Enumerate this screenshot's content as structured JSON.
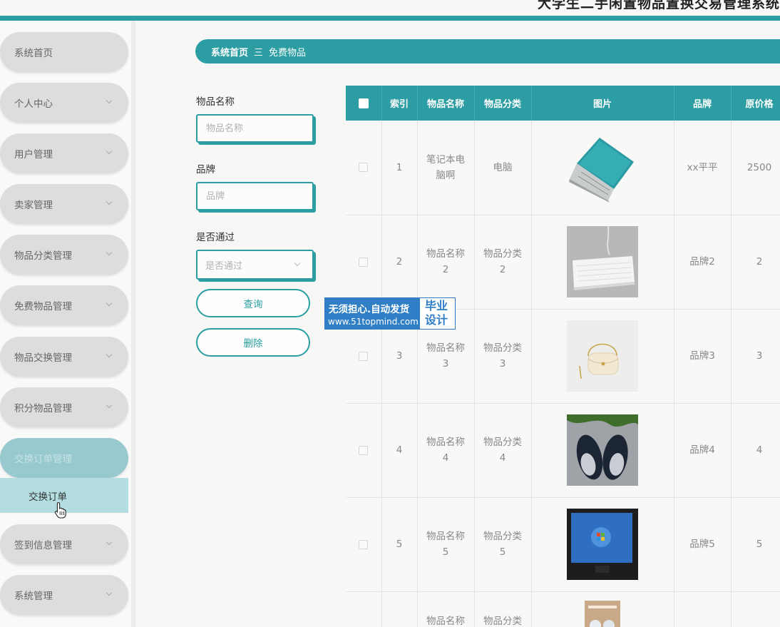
{
  "header": {
    "title": "大学生二手闲置物品置换交易管理系统"
  },
  "sidebar": {
    "items": [
      {
        "label": "系统首页"
      },
      {
        "label": "个人中心"
      },
      {
        "label": "用户管理"
      },
      {
        "label": "卖家管理"
      },
      {
        "label": "物品分类管理"
      },
      {
        "label": "免费物品管理"
      },
      {
        "label": "物品交换管理"
      },
      {
        "label": "积分物品管理"
      },
      {
        "label": "交换订单管理"
      },
      {
        "label": "签到信息管理"
      },
      {
        "label": "系统管理"
      }
    ],
    "submenu_label": "交换订单"
  },
  "breadcrumb": {
    "home": "系统首页",
    "separator": "三",
    "current": "免费物品"
  },
  "search": {
    "name_label": "物品名称",
    "name_placeholder": "物品名称",
    "brand_label": "品牌",
    "brand_placeholder": "品牌",
    "pass_label": "是否通过",
    "pass_placeholder": "是否通过",
    "query_button": "查询",
    "delete_button": "删除"
  },
  "watermark": {
    "line1": "无须担心.自动发货",
    "line2": "www.51topmind.com",
    "right1": "毕业",
    "right2": "设计"
  },
  "table": {
    "headers": [
      "索引",
      "物品名称",
      "物品分类",
      "图片",
      "品牌",
      "原价格"
    ],
    "rows": [
      {
        "index": "1",
        "name": "笔记本电脑啊",
        "category": "电脑",
        "image": "laptop-image",
        "brand": "xx平平",
        "price": "2500"
      },
      {
        "index": "2",
        "name": "物品名称2",
        "category": "物品分类2",
        "image": "keyboard-image",
        "brand": "品牌2",
        "price": "2"
      },
      {
        "index": "3",
        "name": "物品名称3",
        "category": "物品分类3",
        "image": "bag-image",
        "brand": "品牌3",
        "price": "3"
      },
      {
        "index": "4",
        "name": "物品名称4",
        "category": "物品分类4",
        "image": "shoes-image",
        "brand": "品牌4",
        "price": "4"
      },
      {
        "index": "5",
        "name": "物品名称5",
        "category": "物品分类5",
        "image": "monitor-image",
        "brand": "品牌5",
        "price": "5"
      },
      {
        "index": "",
        "name": "物品名称",
        "category": "物品分类",
        "image": "box-image",
        "brand": "",
        "price": ""
      }
    ]
  },
  "colors": {
    "accent": "#2c9ea3",
    "sidebar_item": "#dcdddc",
    "active_item": "#97c9ce",
    "watermark_blue": "#2f7ec6"
  }
}
